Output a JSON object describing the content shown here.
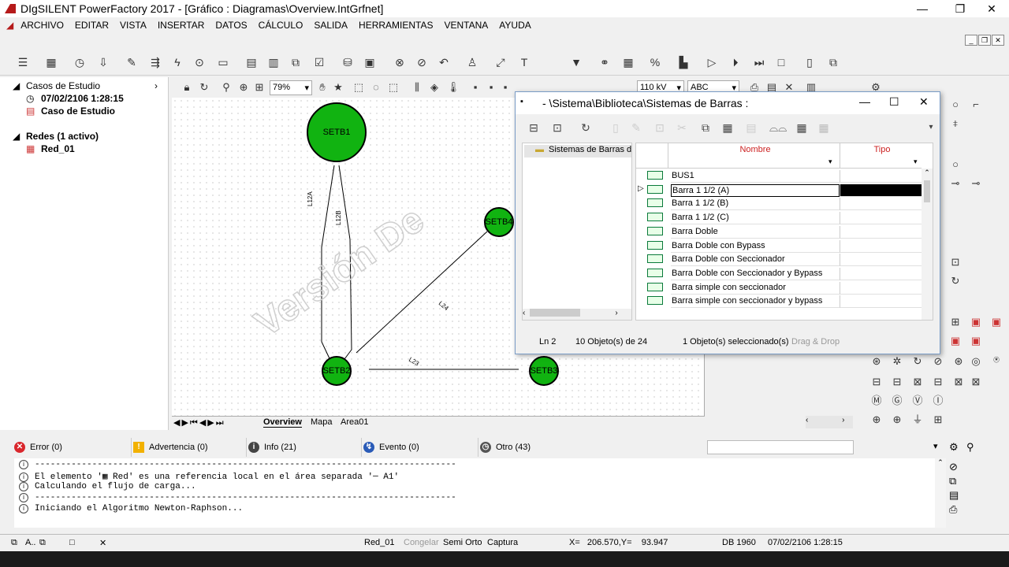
{
  "app": {
    "title": "DIgSILENT PowerFactory 2017 - [Gráfico : Diagramas\\Overview.IntGrfnet]",
    "menu": [
      "ARCHIVO",
      "EDITAR",
      "VISTA",
      "INSERTAR",
      "DATOS",
      "CÁLCULO",
      "SALIDA",
      "HERRAMIENTAS",
      "VENTANA",
      "AYUDA"
    ]
  },
  "tree": {
    "study_cases": "Casos de Estudio",
    "case_time": "07/02/2106 1:28:15",
    "case_name": "Caso de Estudio",
    "networks": "Redes (1 activo)",
    "network": "Red_01"
  },
  "canvas_toolbar": {
    "zoom": "79%",
    "voltage": "110 kV",
    "text_style": "ABC"
  },
  "diagram": {
    "nodes": [
      "SETB1",
      "SETB4",
      "SETB2",
      "SETB3"
    ],
    "lines": [
      "L12A",
      "L12B",
      "L24",
      "L23"
    ],
    "watermark": "Versión De",
    "tabs": [
      "Overview",
      "Mapa",
      "Area01"
    ]
  },
  "dialog": {
    "title": "- \\Sistema\\Biblioteca\\Sistemas de Barras :",
    "tree_item": "Sistemas de Barras d",
    "col_name": "Nombre",
    "col_type": "Tipo",
    "rows": [
      "BUS1",
      "Barra 1 1/2 (A)",
      "Barra 1 1/2 (B)",
      "Barra 1 1/2 (C)",
      "Barra Doble",
      "Barra Doble con Bypass",
      "Barra Doble con Seccionador",
      "Barra Doble con Seccionador y Bypass",
      "Barra simple con seccionador",
      "Barra simple con seccionador y bypass"
    ],
    "selected_row": 1,
    "status_ln": "Ln 2",
    "status_objs": "10 Objeto(s) de 24",
    "status_sel": "1 Objeto(s) seleccionado(s)",
    "status_dd": "Drag & Drop"
  },
  "messages": {
    "tabs": [
      {
        "label": "Error (0)",
        "color": "#d9262c",
        "glyph": "✕"
      },
      {
        "label": "Advertencia (0)",
        "color": "#f2b100",
        "glyph": "!"
      },
      {
        "label": "Info (21)",
        "color": "#444444",
        "glyph": "i"
      },
      {
        "label": "Evento (0)",
        "color": "#2a5bb7",
        "glyph": "↯"
      },
      {
        "label": "Otro (43)",
        "color": "#555555",
        "glyph": "◷"
      }
    ],
    "lines": [
      "---------------------------------------------------------------------------------",
      "El elemento '▦ Red' es una referencia local en el área separada '─ A1'",
      "Calculando el flujo de carga...",
      "---------------------------------------------------------------------------------",
      "Iniciando el Algoritmo Newton-Raphson..."
    ]
  },
  "status": {
    "left": "A..",
    "net": "Red_01",
    "freeze": "Congelar",
    "ortho": "Semi Orto",
    "capture": "Captura",
    "coords": "X=   206.570,Y=    93.947",
    "db": "DB 1960",
    "time": "07/02/2106 1:28:15"
  }
}
